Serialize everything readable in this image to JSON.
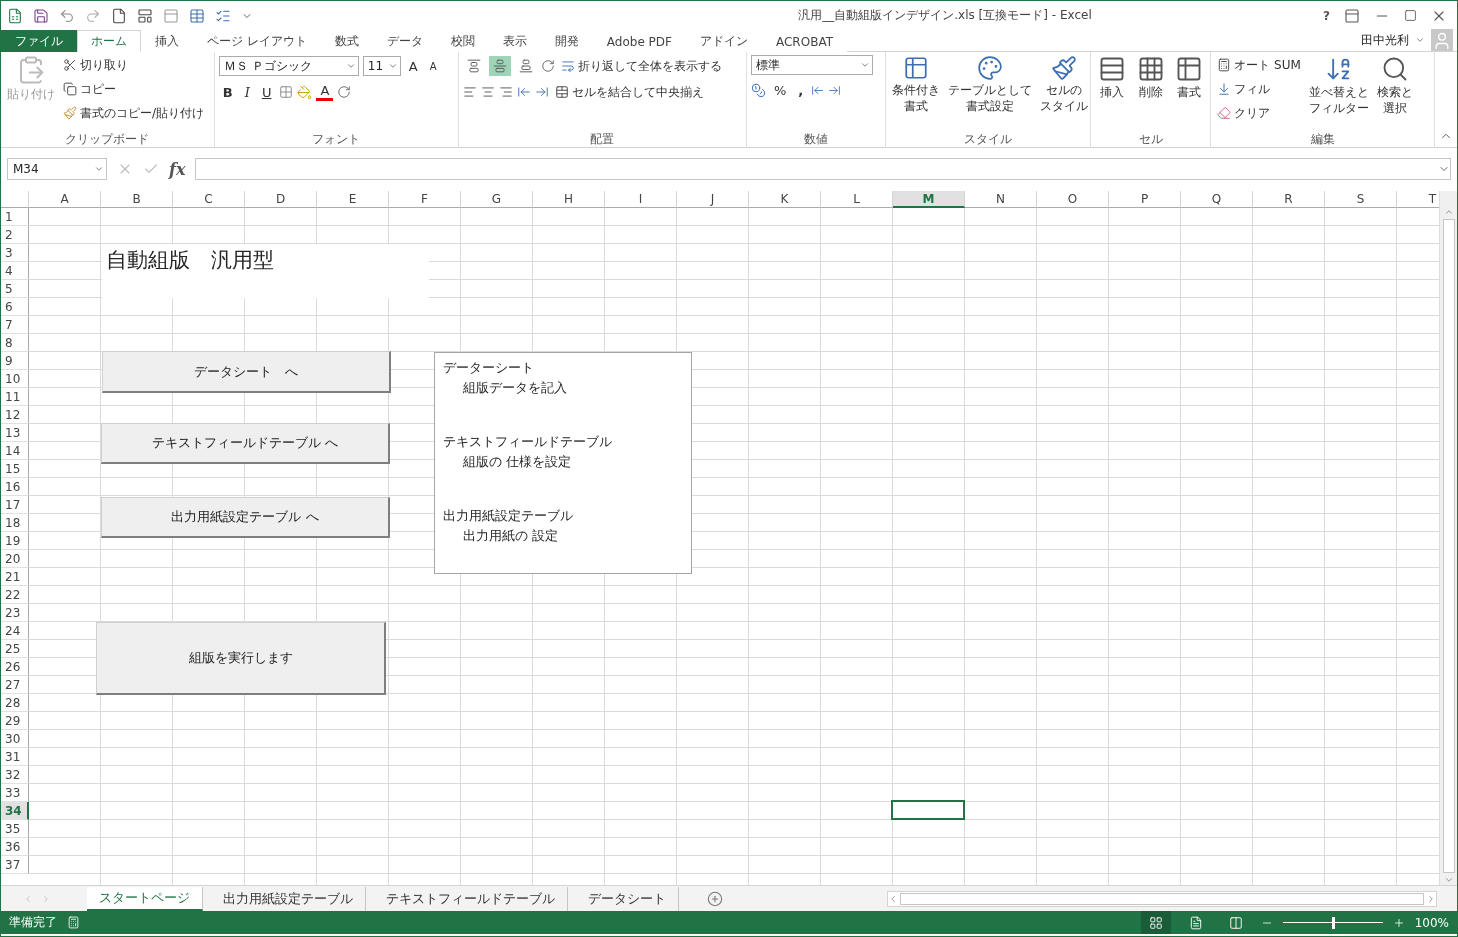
{
  "window": {
    "title": "汎用__自動組版インデザイン.xls  [互換モード] - Excel",
    "help": "?"
  },
  "ribbon_tabs": [
    {
      "label": "ファイル",
      "kind": "file",
      "selected": false
    },
    {
      "label": "ホーム",
      "kind": "tab",
      "selected": true
    },
    {
      "label": "挿入",
      "kind": "tab",
      "selected": false
    },
    {
      "label": "ページ レイアウト",
      "kind": "tab",
      "selected": false
    },
    {
      "label": "数式",
      "kind": "tab",
      "selected": false
    },
    {
      "label": "データ",
      "kind": "tab",
      "selected": false
    },
    {
      "label": "校閲",
      "kind": "tab",
      "selected": false
    },
    {
      "label": "表示",
      "kind": "tab",
      "selected": false
    },
    {
      "label": "開発",
      "kind": "tab",
      "selected": false
    },
    {
      "label": "Adobe PDF",
      "kind": "tab",
      "selected": false
    },
    {
      "label": "アドイン",
      "kind": "tab",
      "selected": false
    },
    {
      "label": "ACROBAT",
      "kind": "tab",
      "selected": false
    }
  ],
  "user": {
    "name": "田中光利"
  },
  "clipboard": {
    "paste": "貼り付け",
    "cut": "切り取り",
    "copy": "コピー",
    "format_painter": "書式のコピー/貼り付け",
    "label": "クリップボード"
  },
  "font": {
    "font_name": "ＭＳ Ｐゴシック",
    "font_size": "11",
    "grow": "A",
    "shrink": "A",
    "bold": "B",
    "italic": "I",
    "underline": "U",
    "font_color": "A",
    "label": "フォント"
  },
  "alignment": {
    "vertical": [
      {
        "kind": "top",
        "selected": false
      },
      {
        "kind": "middle",
        "selected": true
      },
      {
        "kind": "bottom",
        "selected": false
      }
    ],
    "wrap": "折り返して全体を表示する",
    "merge": "セルを結合して中央揃え",
    "label": "配置"
  },
  "number": {
    "format": "標準",
    "percent": "%",
    "comma": ",",
    "label": "数値"
  },
  "styles": {
    "items": [
      {
        "lines": [
          "条件付き",
          "書式"
        ]
      },
      {
        "lines": [
          "テーブルとして",
          "書式設定"
        ]
      },
      {
        "lines": [
          "セルの",
          "スタイル"
        ]
      }
    ],
    "label": "スタイル"
  },
  "cells": {
    "items": [
      {
        "kind": "insert",
        "label": "挿入"
      },
      {
        "kind": "delete",
        "label": "削除"
      },
      {
        "kind": "format",
        "label": "書式"
      }
    ],
    "label": "セル"
  },
  "editing": {
    "autosum": "オート SUM",
    "fill": "フィル",
    "clear": "クリア",
    "sort": [
      "並べ替えと",
      "フィルター"
    ],
    "find": [
      "検索と",
      "選択"
    ],
    "label": "編集"
  },
  "formula_bar": {
    "name_box": "M34",
    "fx": "fx"
  },
  "sheet": {
    "columns": [
      {
        "label": "A",
        "selected": false
      },
      {
        "label": "B",
        "selected": false
      },
      {
        "label": "C",
        "selected": false
      },
      {
        "label": "D",
        "selected": false
      },
      {
        "label": "E",
        "selected": false
      },
      {
        "label": "F",
        "selected": false
      },
      {
        "label": "G",
        "selected": false
      },
      {
        "label": "H",
        "selected": false
      },
      {
        "label": "I",
        "selected": false
      },
      {
        "label": "J",
        "selected": false
      },
      {
        "label": "K",
        "selected": false
      },
      {
        "label": "L",
        "selected": false
      },
      {
        "label": "M",
        "selected": true
      },
      {
        "label": "N",
        "selected": false
      },
      {
        "label": "O",
        "selected": false
      },
      {
        "label": "P",
        "selected": false
      },
      {
        "label": "Q",
        "selected": false
      },
      {
        "label": "R",
        "selected": false
      },
      {
        "label": "S",
        "selected": false
      },
      {
        "label": "T",
        "selected": false
      }
    ],
    "rows": [
      {
        "label": "1",
        "selected": false
      },
      {
        "label": "2",
        "selected": false
      },
      {
        "label": "3",
        "selected": false
      },
      {
        "label": "4",
        "selected": false
      },
      {
        "label": "5",
        "selected": false
      },
      {
        "label": "6",
        "selected": false
      },
      {
        "label": "7",
        "selected": false
      },
      {
        "label": "8",
        "selected": false
      },
      {
        "label": "9",
        "selected": false
      },
      {
        "label": "10",
        "selected": false
      },
      {
        "label": "11",
        "selected": false
      },
      {
        "label": "12",
        "selected": false
      },
      {
        "label": "13",
        "selected": false
      },
      {
        "label": "14",
        "selected": false
      },
      {
        "label": "15",
        "selected": false
      },
      {
        "label": "16",
        "selected": false
      },
      {
        "label": "17",
        "selected": false
      },
      {
        "label": "18",
        "selected": false
      },
      {
        "label": "19",
        "selected": false
      },
      {
        "label": "20",
        "selected": false
      },
      {
        "label": "21",
        "selected": false
      },
      {
        "label": "22",
        "selected": false
      },
      {
        "label": "23",
        "selected": false
      },
      {
        "label": "24",
        "selected": false
      },
      {
        "label": "25",
        "selected": false
      },
      {
        "label": "26",
        "selected": false
      },
      {
        "label": "27",
        "selected": false
      },
      {
        "label": "28",
        "selected": false
      },
      {
        "label": "29",
        "selected": false
      },
      {
        "label": "30",
        "selected": false
      },
      {
        "label": "31",
        "selected": false
      },
      {
        "label": "32",
        "selected": false
      },
      {
        "label": "33",
        "selected": false
      },
      {
        "label": "34",
        "selected": true
      },
      {
        "label": "35",
        "selected": false
      },
      {
        "label": "36",
        "selected": false
      },
      {
        "label": "37",
        "selected": false
      }
    ],
    "title": "自動組版　汎用型",
    "buttons": [
      "データシート　へ",
      "テキストフィールドテーブル へ",
      "出力用紙設定テーブル へ",
      "組版を実行します"
    ],
    "notes": [
      {
        "heading": "データーシート",
        "detail": "組版データを記入"
      },
      {
        "heading": "テキストフィールドテーブル",
        "detail": "組版の 仕様を設定"
      },
      {
        "heading": "出力用紙設定テーブル",
        "detail": "出力用紙の 設定"
      }
    ]
  },
  "sheet_tabs": [
    {
      "label": "スタートページ",
      "selected": true
    },
    {
      "label": "出力用紙設定テーブル",
      "selected": false
    },
    {
      "label": "テキストフィールドテーブル",
      "selected": false
    },
    {
      "label": "データシート",
      "selected": false
    }
  ],
  "status_bar": {
    "status": "準備完了",
    "views": [
      {
        "kind": "normal",
        "selected": true
      },
      {
        "kind": "layout",
        "selected": false
      },
      {
        "kind": "pagebreak",
        "selected": false
      }
    ],
    "zoom": {
      "level": 0.5,
      "reading": "100%"
    }
  }
}
